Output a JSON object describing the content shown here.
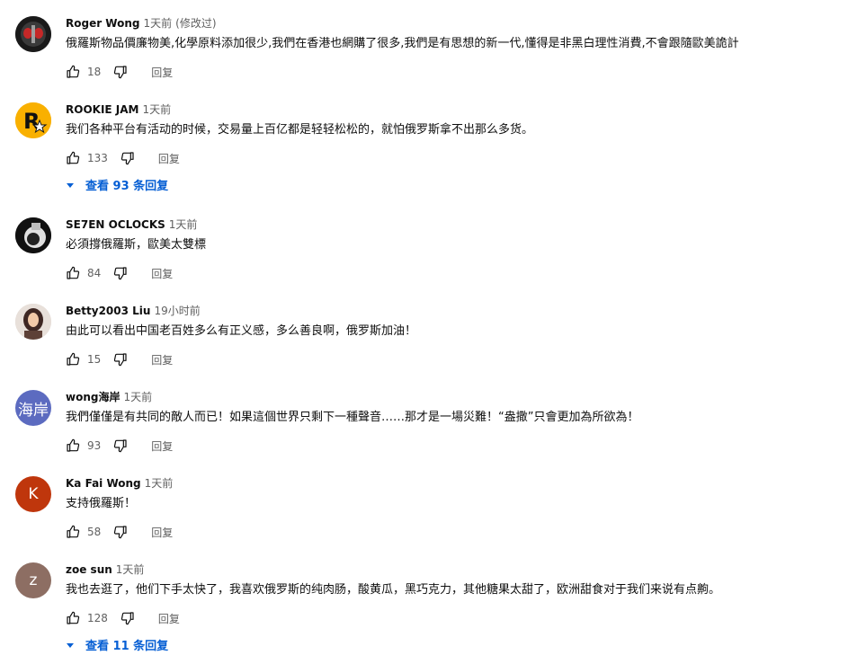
{
  "comments": [
    {
      "author": "Roger Wong",
      "time": "1天前",
      "edited": "(修改过)",
      "text": "俄羅斯物品價廉物美,化學原料添加很少,我們在香港也網購了很多,我們是有思想的新一代,懂得是非黑白理性消費,不會跟隨歐美詭計",
      "likes": "18",
      "reply": "回复"
    },
    {
      "author": "ROOKIE JAM",
      "time": "1天前",
      "text": "我们各种平台有活动的时候，交易量上百亿都是轻轻松松的，就怕俄罗斯拿不出那么多货。",
      "likes": "133",
      "reply": "回复",
      "view_replies": "查看 93 条回复"
    },
    {
      "author": "SE7EN OCLOCKS",
      "time": "1天前",
      "text": "必須撐俄羅斯，歐美太雙標",
      "likes": "84",
      "reply": "回复"
    },
    {
      "author": "Betty2003 Liu",
      "time": "19小时前",
      "text": "由此可以看出中国老百姓多么有正义感，多么善良啊，俄罗斯加油！",
      "likes": "15",
      "reply": "回复"
    },
    {
      "author": "wong海岸",
      "time": "1天前",
      "avatar_text": "海岸",
      "text": "我們僅僅是有共同的敵人而已！如果這個世界只剩下一種聲音……那才是一場災難！“盎撒”只會更加為所欲為！",
      "likes": "93",
      "reply": "回复"
    },
    {
      "author": "Ka Fai Wong",
      "time": "1天前",
      "avatar_text": "K",
      "text": "支持俄羅斯！",
      "likes": "58",
      "reply": "回复"
    },
    {
      "author": "zoe sun",
      "time": "1天前",
      "avatar_text": "z",
      "text": "我也去逛了，他们下手太快了，我喜欢俄罗斯的纯肉肠，酸黄瓜，黑巧克力，其他糖果太甜了，欧洲甜食对于我们来说有点齁。",
      "likes": "128",
      "reply": "回复",
      "view_replies": "查看 11 条回复"
    }
  ],
  "colors": {
    "link": "#065fd4",
    "secondary_text": "#606060",
    "avatar_wong": "#5c6bc0",
    "avatar_kafai": "#bf360c",
    "avatar_zoe": "#8d6e63"
  },
  "icons": [
    "like-icon",
    "dislike-icon",
    "chevron-down-icon"
  ]
}
